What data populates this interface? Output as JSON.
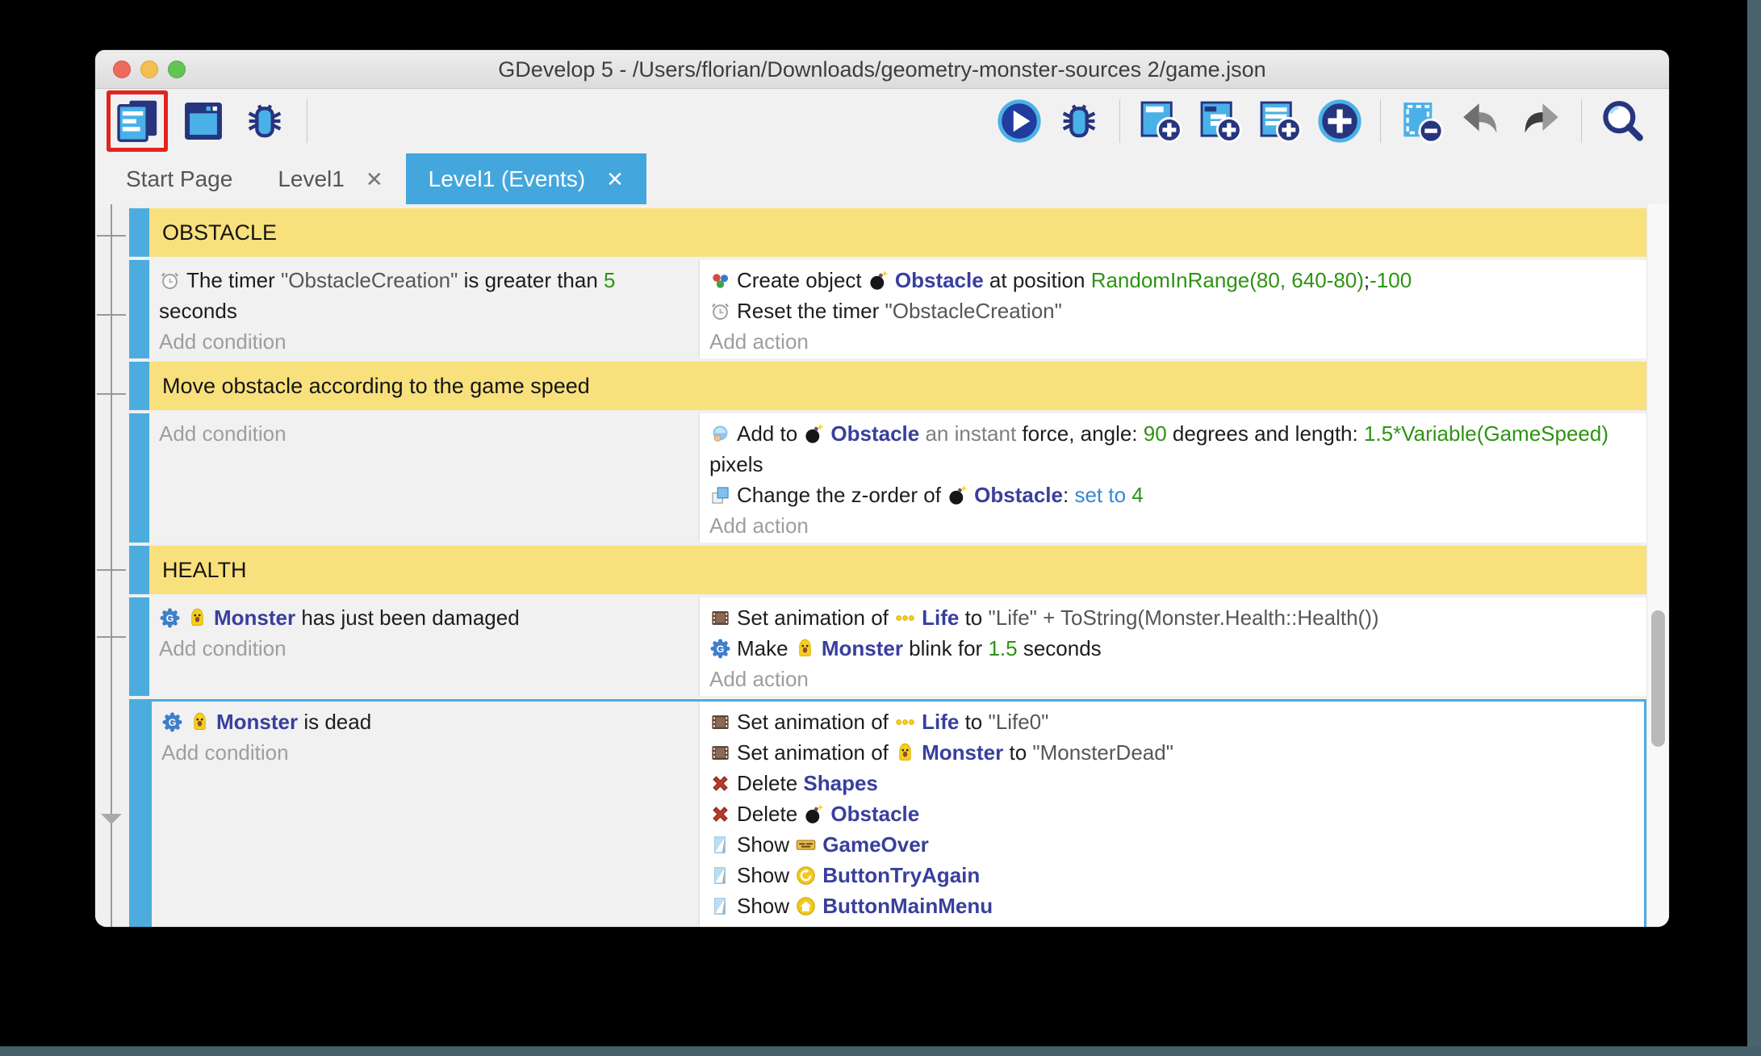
{
  "window": {
    "title": "GDevelop 5 - /Users/florian/Downloads/geometry-monster-sources 2/game.json"
  },
  "colors": {
    "accent_blue": "#43a7dd",
    "event_bar_blue": "#4dacde",
    "group_yellow": "#f8e07c",
    "selection_border": "#4faadf",
    "object_name": "#383f9c",
    "expression_green": "#2e9312",
    "operator_blue": "#3887d5",
    "highlight_red": "#e3241d"
  },
  "toolbar": {
    "left": [
      {
        "type": "button",
        "icon": "events-sheet-icon",
        "name": "toolbar-button-events-sheet",
        "highlighted": true
      },
      {
        "type": "button",
        "icon": "scene-editor-icon",
        "name": "toolbar-button-scene-editor"
      },
      {
        "type": "button",
        "icon": "debugger-icon",
        "name": "toolbar-button-debugger"
      },
      {
        "type": "separator"
      }
    ],
    "right": [
      {
        "type": "button",
        "icon": "play-icon",
        "name": "toolbar-button-preview"
      },
      {
        "type": "button",
        "icon": "debug-icon",
        "name": "toolbar-button-debug"
      },
      {
        "type": "separator"
      },
      {
        "type": "button",
        "icon": "add-event-icon",
        "name": "toolbar-button-add-event"
      },
      {
        "type": "button",
        "icon": "add-subevent-icon",
        "name": "toolbar-button-add-subevent"
      },
      {
        "type": "button",
        "icon": "add-comment-icon",
        "name": "toolbar-button-add-comment"
      },
      {
        "type": "button",
        "icon": "add-circle-icon",
        "name": "toolbar-button-add-more"
      },
      {
        "type": "separator"
      },
      {
        "type": "button",
        "icon": "delete-event-icon",
        "name": "toolbar-button-delete-event"
      },
      {
        "type": "button",
        "icon": "undo-icon",
        "name": "toolbar-button-undo"
      },
      {
        "type": "button",
        "icon": "redo-icon",
        "name": "toolbar-button-redo"
      },
      {
        "type": "separator"
      },
      {
        "type": "button",
        "icon": "search-icon",
        "name": "toolbar-button-search"
      }
    ]
  },
  "tabs": [
    {
      "label": "Start Page",
      "close": false,
      "active": false
    },
    {
      "label": "Level1",
      "close": true,
      "active": false
    },
    {
      "label": "Level1 (Events)",
      "close": true,
      "active": true
    }
  ],
  "labels": {
    "add_condition": "Add condition",
    "add_action": "Add action"
  },
  "events": [
    {
      "type": "group",
      "label": "OBSTACLE"
    },
    {
      "type": "event",
      "conditions": [
        [
          {
            "i": "timer-icon"
          },
          {
            "t": "The timer "
          },
          {
            "t": "\"ObstacleCreation\"",
            "s": "str"
          },
          {
            "t": " is greater than "
          },
          {
            "t": "5",
            "s": "num"
          },
          {
            "t": " seconds"
          }
        ]
      ],
      "actions": [
        [
          {
            "i": "create-object-icon"
          },
          {
            "t": "Create object "
          },
          {
            "i": "bomb-icon"
          },
          {
            "t": "Obstacle",
            "s": "obj"
          },
          {
            "t": " at position "
          },
          {
            "t": "RandomInRange(80, 640-80)",
            "s": "num"
          },
          {
            "t": ";",
            "s": "plain"
          },
          {
            "t": "-100",
            "s": "num"
          }
        ],
        [
          {
            "i": "timer-icon"
          },
          {
            "t": "Reset the timer "
          },
          {
            "t": "\"ObstacleCreation\"",
            "s": "str"
          }
        ]
      ]
    },
    {
      "type": "group",
      "label": "Move obstacle according to the game speed"
    },
    {
      "type": "event",
      "conditions": [],
      "actions": [
        [
          {
            "i": "force-icon"
          },
          {
            "t": "Add to "
          },
          {
            "i": "bomb-icon"
          },
          {
            "t": "Obstacle",
            "s": "obj"
          },
          {
            "t": " an instant ",
            "s": "muted"
          },
          {
            "t": "force, angle: "
          },
          {
            "t": "90",
            "s": "num"
          },
          {
            "t": " degrees and length: "
          },
          {
            "t": "1.5*Variable(GameSpeed)",
            "s": "num"
          },
          {
            "t": " pixels"
          }
        ],
        [
          {
            "i": "zorder-icon"
          },
          {
            "t": "Change the z-order of "
          },
          {
            "i": "bomb-icon"
          },
          {
            "t": "Obstacle",
            "s": "obj"
          },
          {
            "t": ": "
          },
          {
            "t": "set to ",
            "s": "kw"
          },
          {
            "t": "4",
            "s": "num"
          }
        ]
      ]
    },
    {
      "type": "group",
      "label": "HEALTH"
    },
    {
      "type": "event",
      "conditions": [
        [
          {
            "i": "behavior-badge-icon"
          },
          {
            "i": "monster-icon"
          },
          {
            "t": "Monster",
            "s": "obj"
          },
          {
            "t": " has just been damaged"
          }
        ]
      ],
      "actions": [
        [
          {
            "i": "animation-icon"
          },
          {
            "t": "Set animation of "
          },
          {
            "i": "life-icon"
          },
          {
            "t": "Life",
            "s": "obj"
          },
          {
            "t": " to "
          },
          {
            "t": "\"Life\" + ToString(Monster.Health::Health())",
            "s": "str"
          }
        ],
        [
          {
            "i": "behavior-badge-icon"
          },
          {
            "t": "Make "
          },
          {
            "i": "monster-icon"
          },
          {
            "t": "Monster",
            "s": "obj"
          },
          {
            "t": " blink for "
          },
          {
            "t": "1.5",
            "s": "num"
          },
          {
            "t": " seconds"
          }
        ]
      ]
    },
    {
      "type": "event",
      "selected": true,
      "conditions": [
        [
          {
            "i": "behavior-badge-icon"
          },
          {
            "i": "monster-icon"
          },
          {
            "t": "Monster",
            "s": "obj"
          },
          {
            "t": " is dead"
          }
        ]
      ],
      "actions": [
        [
          {
            "i": "animation-icon"
          },
          {
            "t": "Set animation of "
          },
          {
            "i": "life-icon"
          },
          {
            "t": "Life",
            "s": "obj"
          },
          {
            "t": " to "
          },
          {
            "t": "\"Life0\"",
            "s": "str"
          }
        ],
        [
          {
            "i": "animation-icon"
          },
          {
            "t": "Set animation of "
          },
          {
            "i": "monster-icon"
          },
          {
            "t": "Monster",
            "s": "obj"
          },
          {
            "t": " to "
          },
          {
            "t": "\"MonsterDead\"",
            "s": "str"
          }
        ],
        [
          {
            "i": "delete-icon"
          },
          {
            "t": "Delete "
          },
          {
            "t": "Shapes",
            "s": "obj"
          }
        ],
        [
          {
            "i": "delete-icon"
          },
          {
            "t": "Delete "
          },
          {
            "i": "bomb-icon"
          },
          {
            "t": "Obstacle",
            "s": "obj"
          }
        ],
        [
          {
            "i": "show-icon"
          },
          {
            "t": "Show "
          },
          {
            "i": "gameover-icon"
          },
          {
            "t": "GameOver",
            "s": "obj"
          }
        ],
        [
          {
            "i": "show-icon"
          },
          {
            "t": "Show "
          },
          {
            "i": "tryagain-icon"
          },
          {
            "t": "ButtonTryAgain",
            "s": "obj"
          }
        ],
        [
          {
            "i": "show-icon"
          },
          {
            "t": "Show "
          },
          {
            "i": "mainmenu-icon"
          },
          {
            "t": "ButtonMainMenu",
            "s": "obj"
          }
        ]
      ]
    }
  ]
}
